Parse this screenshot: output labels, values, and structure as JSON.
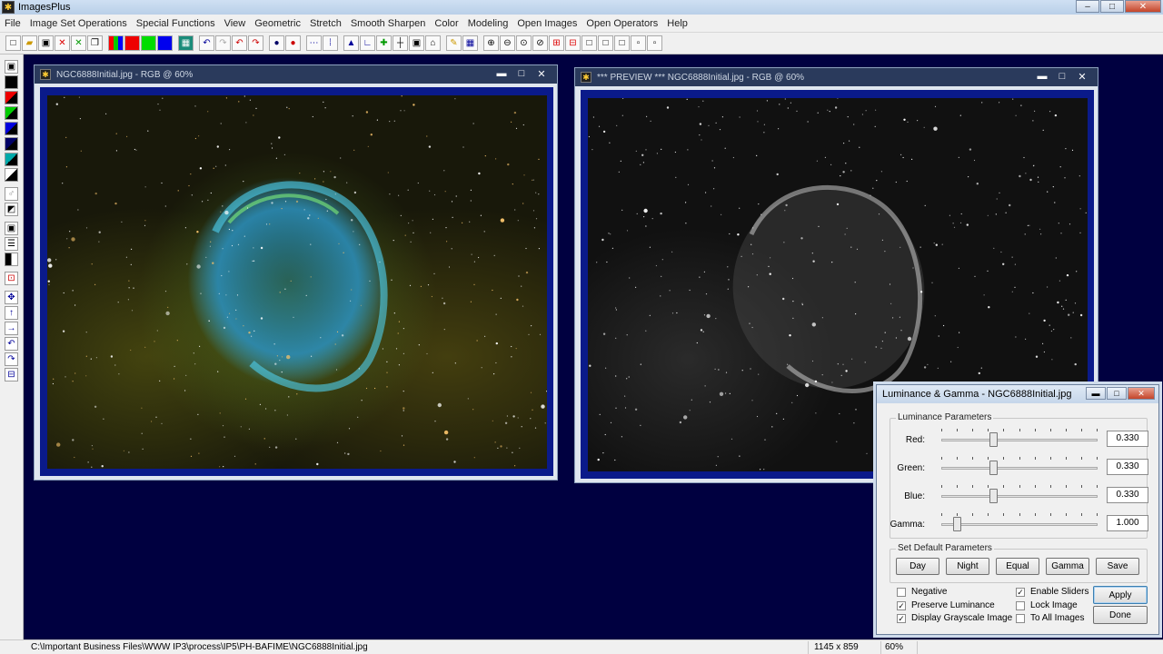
{
  "app": {
    "title": "ImagesPlus",
    "window_controls": [
      "–",
      "□",
      "✕"
    ]
  },
  "menu": [
    "File",
    "Image Set Operations",
    "Special Functions",
    "View",
    "Geometric",
    "Stretch",
    "Smooth Sharpen",
    "Color",
    "Modeling",
    "Open Images",
    "Open Operators",
    "Help"
  ],
  "toolbar_icons": [
    "new-icon",
    "open-icon",
    "save-icon",
    "close-red-icon",
    "close-green-icon",
    "copy-icon",
    "rgb-channels-icon",
    "red-channel-icon",
    "green-channel-icon",
    "blue-channel-icon",
    "grid-icon",
    "undo-icon",
    "redo-icon",
    "undo-all-icon",
    "redo-all-icon",
    "circle-select-icon",
    "circle-record-icon",
    "dotted-line-icon",
    "point-icon",
    "triangle-icon",
    "angle-icon",
    "plus-green-icon",
    "crosshair-icon",
    "frame-icon",
    "home-icon",
    "pencil-icon",
    "grid-select-icon",
    "zoom-in-icon",
    "zoom-out-icon",
    "zoom-fit-icon",
    "zoom-reset-icon",
    "add-red-icon",
    "minus-red-icon",
    "box1-icon",
    "box2-icon",
    "box3-icon",
    "box4-icon",
    "box5-icon"
  ],
  "left_tools": [
    "save-icon",
    "black-icon",
    "red-black-icon",
    "green-black-icon",
    "blue-black-icon",
    "navy-black-icon",
    "teal-black-icon",
    "black-white-icon",
    "gray-icon",
    "diagonal-icon",
    "square-icon",
    "bars-icon",
    "column-icon",
    "select-icon",
    "move-icon",
    "arrow-up-icon",
    "arrow-right-icon",
    "rotate-left-icon",
    "rotate-right-icon",
    "frame-icon"
  ],
  "windows": {
    "original": {
      "title": "NGC6888Initial.jpg - RGB @ 60%",
      "controls": [
        "▬",
        "□",
        "✕"
      ]
    },
    "preview": {
      "title": "*** PREVIEW *** NGC6888Initial.jpg - RGB @ 60%",
      "controls": [
        "▬",
        "□",
        "✕"
      ]
    }
  },
  "dialog": {
    "title": "Luminance & Gamma - NGC6888Initial.jpg",
    "controls": [
      "▬",
      "□",
      "✕"
    ],
    "luminance_group": "Luminance Parameters",
    "sliders": [
      {
        "label": "Red:",
        "value": "0.330",
        "level": 0.33
      },
      {
        "label": "Green:",
        "value": "0.330",
        "level": 0.33
      },
      {
        "label": "Blue:",
        "value": "0.330",
        "level": 0.33
      },
      {
        "label": "Gamma:",
        "value": "1.000",
        "level": 0.1
      }
    ],
    "defaults_group": "Set Default Parameters",
    "default_buttons": [
      "Day",
      "Night",
      "Equal",
      "Gamma",
      "Save"
    ],
    "checks_left": [
      {
        "label": "Negative",
        "checked": false
      },
      {
        "label": "Preserve Luminance",
        "checked": true
      },
      {
        "label": "Display Grayscale Image",
        "checked": true
      }
    ],
    "checks_right": [
      {
        "label": "Enable Sliders",
        "checked": true
      },
      {
        "label": "Lock Image",
        "checked": false
      },
      {
        "label": "To All Images",
        "checked": false
      }
    ],
    "apply_label": "Apply",
    "done_label": "Done"
  },
  "status": {
    "path": "C:\\Important Business Files\\WWW IP3\\process\\IP5\\PH-BAFIME\\NGC6888Initial.jpg",
    "dimensions": "1145 x 859",
    "zoom": "60%"
  }
}
